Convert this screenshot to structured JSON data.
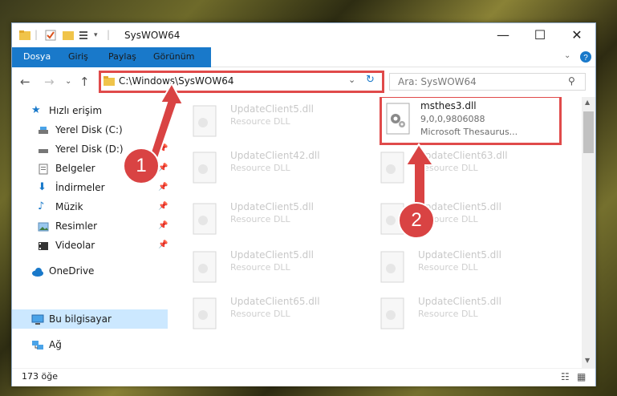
{
  "window": {
    "title": "SysWOW64"
  },
  "ribbon": {
    "tabs": [
      "Dosya",
      "Giriş",
      "Paylaş",
      "Görünüm"
    ]
  },
  "address": {
    "path": "C:\\Windows\\SysWOW64"
  },
  "search": {
    "placeholder": "Ara: SysWOW64"
  },
  "sidebar": {
    "items": [
      {
        "label": "Hızlı erişim"
      },
      {
        "label": "Yerel Disk (C:)"
      },
      {
        "label": "Yerel Disk (D:)"
      },
      {
        "label": "Belgeler"
      },
      {
        "label": "İndirmeler"
      },
      {
        "label": "Müzik"
      },
      {
        "label": "Resimler"
      },
      {
        "label": "Videolar"
      },
      {
        "label": "OneDrive"
      },
      {
        "label": "Bu bilgisayar"
      },
      {
        "label": "Ağ"
      }
    ]
  },
  "files": [
    {
      "name": "UpdateClient5.dll",
      "desc": "Resource DLL"
    },
    {
      "name": "msthes3.dll",
      "desc": "9,0,0,9806088",
      "desc2": "Microsoft Thesaurus..."
    },
    {
      "name": "UpdateClient42.dll",
      "desc": "Resource DLL"
    },
    {
      "name": "UpdateClient63.dll",
      "desc": "Resource DLL"
    },
    {
      "name": "UpdateClient5.dll",
      "desc": "Resource DLL"
    },
    {
      "name": "UpdateClient5.dll",
      "desc": "Resource DLL"
    },
    {
      "name": "UpdateClient5.dll",
      "desc": "Resource DLL"
    },
    {
      "name": "UpdateClient5.dll",
      "desc": "Resource DLL"
    },
    {
      "name": "UpdateClient65.dll",
      "desc": "Resource DLL"
    },
    {
      "name": "UpdateClient5.dll",
      "desc": "Resource DLL"
    }
  ],
  "status": {
    "count": "173 öğe"
  },
  "callouts": [
    "1",
    "2"
  ]
}
